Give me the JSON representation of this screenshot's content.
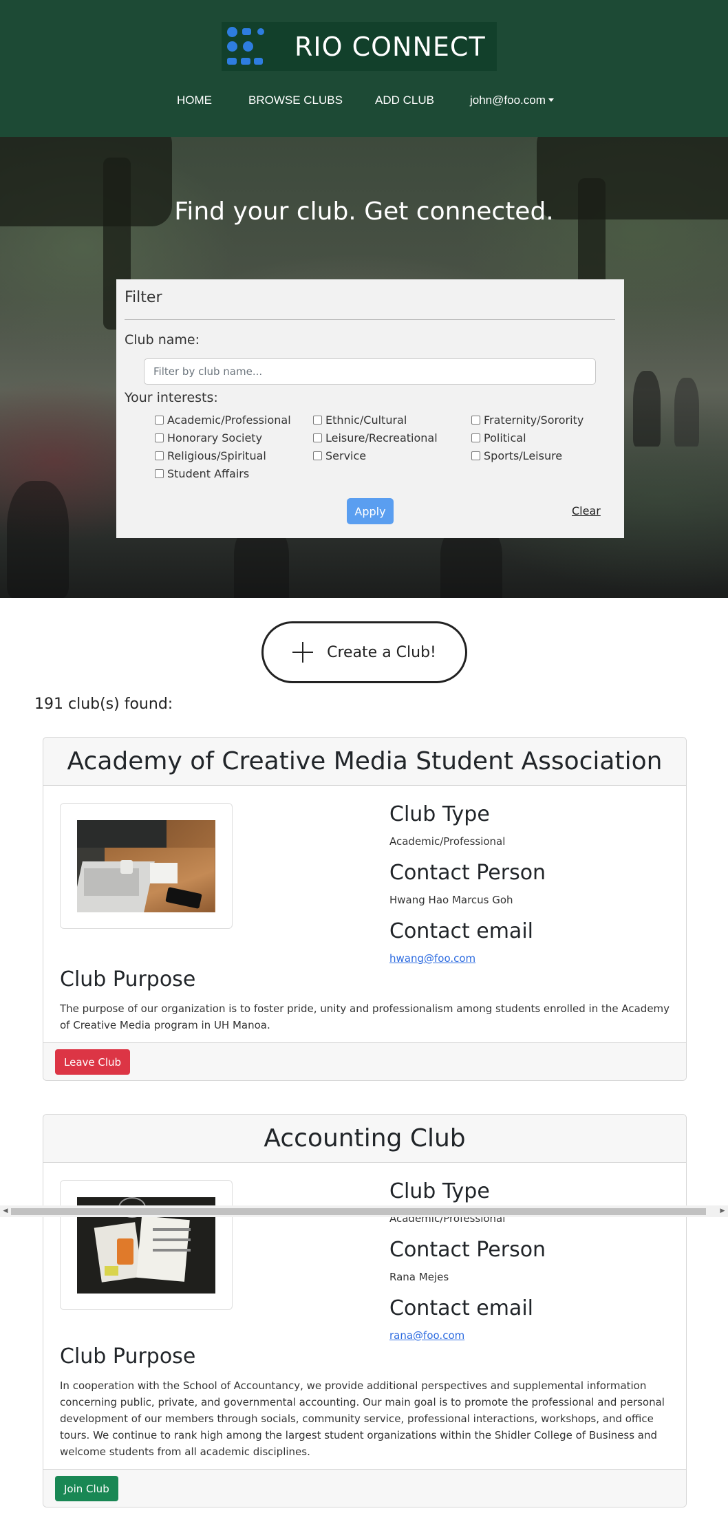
{
  "header": {
    "brand": "RIO CONNECT",
    "nav": {
      "home": "HOME",
      "browse": "BROWSE CLUBS",
      "add": "ADD CLUB",
      "user": "john@foo.com"
    }
  },
  "hero": {
    "title": "Find your club. Get connected."
  },
  "filter": {
    "title": "Filter",
    "club_name_label": "Club name:",
    "club_name_placeholder": "Filter by club name...",
    "interests_label": "Your interests:",
    "interests": [
      "Academic/Professional",
      "Ethnic/Cultural",
      "Fraternity/Sorority",
      "Honorary Society",
      "Leisure/Recreational",
      "Political",
      "Religious/Spiritual",
      "Service",
      "Sports/Leisure",
      "Student Affairs"
    ],
    "apply": "Apply",
    "clear": "Clear"
  },
  "create_button": "Create a Club!",
  "count_text": "191 club(s) found:",
  "labels": {
    "club_type": "Club Type",
    "contact_person": "Contact Person",
    "contact_email": "Contact email",
    "club_purpose": "Club Purpose"
  },
  "clubs": [
    {
      "name": "Academy of Creative Media Student Association",
      "type": "Academic/Professional",
      "contact": "Hwang Hao Marcus Goh",
      "email": "hwang@foo.com",
      "purpose": "The purpose of our organization is to foster pride, unity and professionalism among students enrolled in the Academy of Creative Media program in UH Manoa.",
      "action": "Leave Club"
    },
    {
      "name": "Accounting Club",
      "type": "Academic/Professional",
      "contact": "Rana Mejes",
      "email": "rana@foo.com",
      "purpose": "In cooperation with the School of Accountancy, we provide additional perspectives and supplemental information concerning public, private, and governmental accounting. Our main goal is to promote the professional and personal development of our members through socials, community service, professional interactions, workshops, and office tours. We continue to rank high among the largest student organizations within the Shidler College of Business and welcome students from all academic disciplines.",
      "action": "Join Club"
    }
  ],
  "colors": {
    "header_bg": "#1d4a35",
    "logo_bg": "#12402b",
    "logo_accent": "#2e7de0",
    "apply": "#5a9ef0",
    "leave": "#dc3545",
    "join": "#198754",
    "link": "#2c6be0"
  }
}
